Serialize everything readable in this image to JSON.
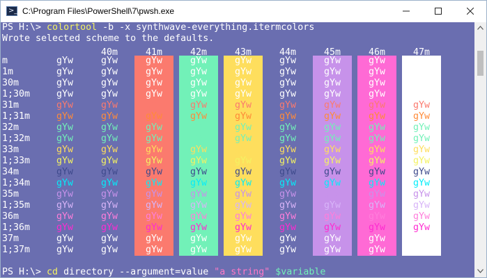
{
  "window": {
    "title": "C:\\Program Files\\PowerShell\\7\\pwsh.exe",
    "buttons": {
      "minimize": "minimize",
      "maximize": "maximize",
      "close": "close"
    }
  },
  "terminal": {
    "line1": {
      "prompt": "PS H:\\> ",
      "command": "colortool",
      "args": " -b -x synthwave-everything.itermcolors"
    },
    "line2": "Wrote selected scheme to the defaults.",
    "table": {
      "bg_headers": [
        "40m",
        "41m",
        "42m",
        "43m",
        "44m",
        "45m",
        "46m",
        "47m"
      ],
      "bg_colors": [
        "",
        "#fb7a6e",
        "#72f1b8",
        "#fede5d",
        "",
        "#c792ea",
        "#ff6ad5",
        "#ffffff"
      ],
      "sample": "gYw",
      "rows": [
        {
          "label": "m",
          "fg": "#ffffff"
        },
        {
          "label": "1m",
          "fg": "#ffffff"
        },
        {
          "label": "30m",
          "fg": "#ffffff"
        },
        {
          "label": "1;30m",
          "fg": "#ffffff"
        },
        {
          "label": "31m",
          "fg": "#fb7a6e"
        },
        {
          "label": "1;31m",
          "fg": "#ff8b39"
        },
        {
          "label": "32m",
          "fg": "#72f1b8"
        },
        {
          "label": "1;32m",
          "fg": "#72f1b8"
        },
        {
          "label": "33m",
          "fg": "#fede5d"
        },
        {
          "label": "1;33m",
          "fg": "#f4f262"
        },
        {
          "label": "34m",
          "fg": "#3e4a8c"
        },
        {
          "label": "1;34m",
          "fg": "#03edf9"
        },
        {
          "label": "35m",
          "fg": "#c792ea"
        },
        {
          "label": "1;35m",
          "fg": "#d8b4f8"
        },
        {
          "label": "36m",
          "fg": "#ff7edb"
        },
        {
          "label": "1;36m",
          "fg": "#ff2ad1"
        },
        {
          "label": "37m",
          "fg": "#ffffff"
        },
        {
          "label": "1;37m",
          "fg": "#ffffff"
        }
      ]
    },
    "line_last": {
      "prompt": "PS H:\\> ",
      "command": "cd",
      "arg1": " directory ",
      "arg2": "--argument=value",
      "string": " \"a string\"",
      "variable": " $variable"
    }
  },
  "colors": {
    "terminal_bg": "#6a6eb0",
    "foreground": "#ffffff"
  },
  "icons": {
    "app": "powershell-icon",
    "scroll_up": "chevron-up-icon",
    "scroll_down": "chevron-down-icon"
  }
}
